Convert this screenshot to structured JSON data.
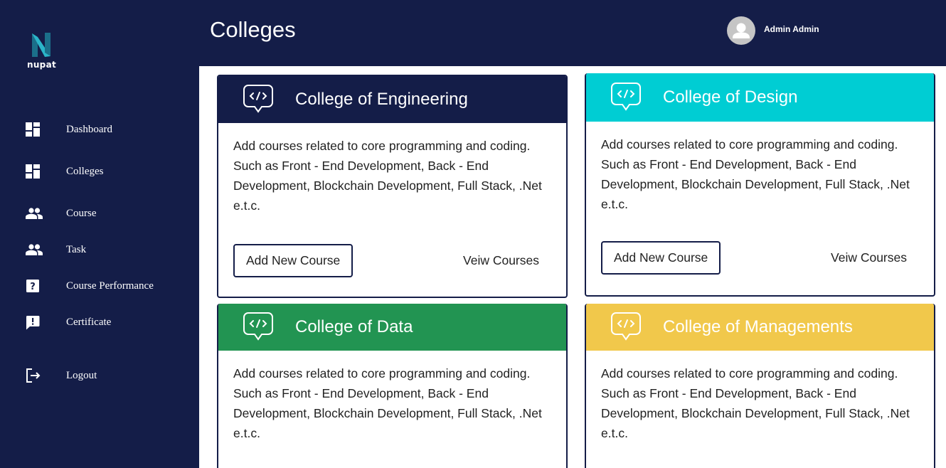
{
  "brand": {
    "name": "nupat"
  },
  "sidebar": {
    "items": [
      {
        "label": "Dashboard",
        "icon": "dashboard-icon"
      },
      {
        "label": "Colleges",
        "icon": "dashboard-icon"
      },
      {
        "label": "Course",
        "icon": "people-icon"
      },
      {
        "label": "Task",
        "icon": "people-icon"
      },
      {
        "label": "Course Performance",
        "icon": "help-box-icon"
      },
      {
        "label": "Certificate",
        "icon": "feedback-icon"
      },
      {
        "label": "Logout",
        "icon": "logout-icon"
      }
    ]
  },
  "header": {
    "title": "Colleges",
    "user_name": "Admin Admin",
    "avatar_icon": "user-avatar-icon"
  },
  "colors": {
    "navy": "#141d48",
    "engineering": "#141d48",
    "design": "#00cdd3",
    "data": "#229452",
    "managements": "#f1c84b"
  },
  "cards": [
    {
      "title": "College of Engineering",
      "description": "Add courses related to core programming and coding. Such as Front - End Development, Back - End Development, Blockchain Development, Full Stack, .Net e.t.c.",
      "add_label": "Add New Course",
      "view_label": "Veiw Courses"
    },
    {
      "title": "College of Design",
      "description": "Add courses related to core programming and coding. Such as Front - End Development, Back - End Development, Blockchain Development, Full Stack, .Net e.t.c.",
      "add_label": "Add New Course",
      "view_label": "Veiw Courses"
    },
    {
      "title": "College of Data",
      "description": "Add courses related to core programming and coding. Such as Front - End Development, Back - End Development, Blockchain Development, Full Stack, .Net e.t.c."
    },
    {
      "title": "College of Managements",
      "description": "Add courses related to core programming and coding. Such as Front - End Development, Back - End Development, Blockchain Development, Full Stack, .Net e.t.c."
    }
  ]
}
